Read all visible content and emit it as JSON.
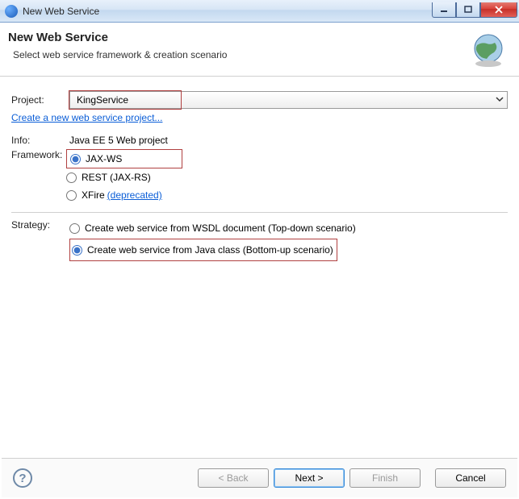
{
  "window": {
    "title": "New Web Service"
  },
  "header": {
    "title": "New Web Service",
    "subtitle": "Select web service framework & creation scenario"
  },
  "labels": {
    "project": "Project:",
    "info": "Info:",
    "framework": "Framework:",
    "strategy": "Strategy:"
  },
  "project": {
    "selected": "KingService",
    "create_link": "Create a new web service project..."
  },
  "info": {
    "text": "Java EE 5 Web project"
  },
  "framework": {
    "options": {
      "jaxws": "JAX-WS",
      "rest": "REST (JAX-RS)",
      "xfire": "XFire",
      "xfire_deprecated": "(deprecated)"
    },
    "selected": "jaxws"
  },
  "strategy": {
    "options": {
      "topdown": "Create web service from WSDL document (Top-down scenario)",
      "bottomup": "Create web service from Java class (Bottom-up scenario)"
    },
    "selected": "bottomup"
  },
  "buttons": {
    "back": "< Back",
    "next": "Next >",
    "finish": "Finish",
    "cancel": "Cancel"
  }
}
